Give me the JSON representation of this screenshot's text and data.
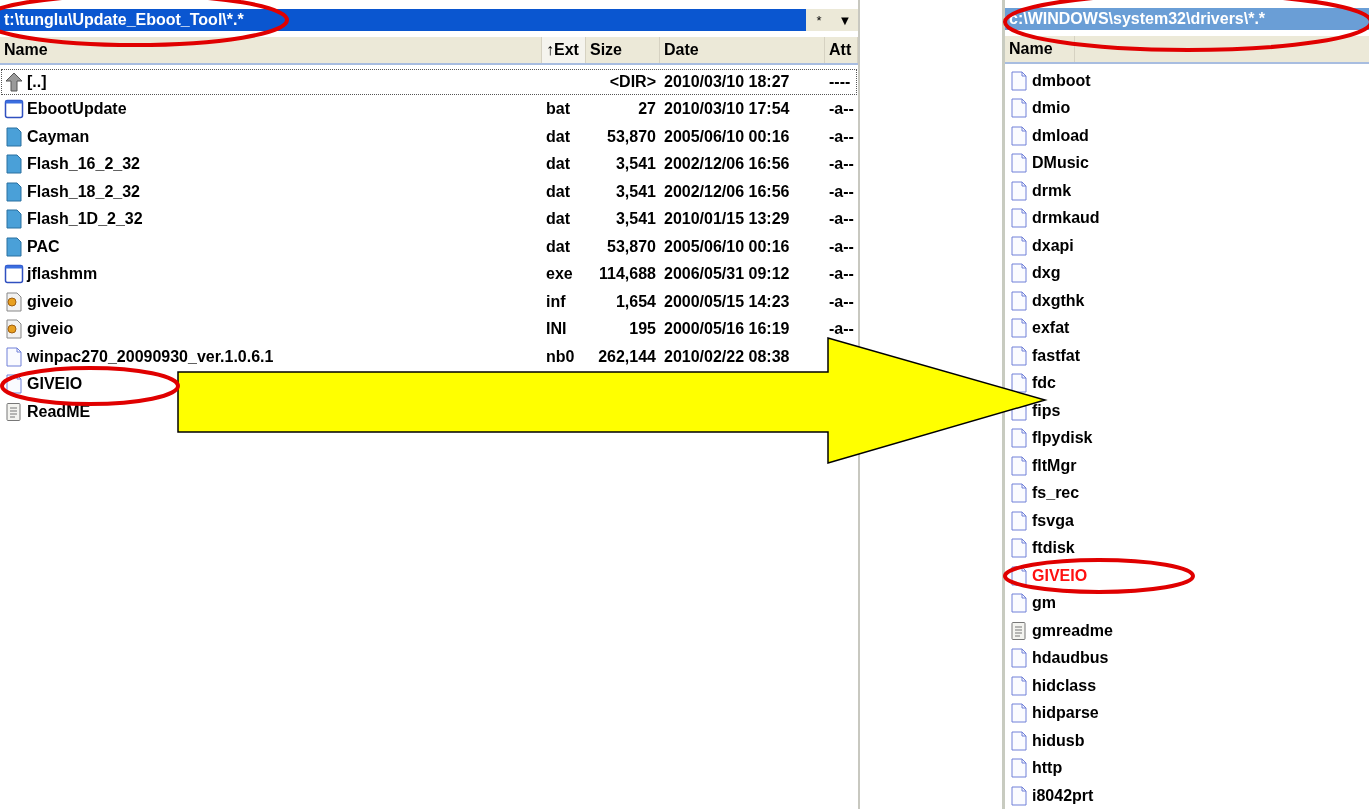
{
  "left_panel": {
    "path": "t:\\tunglu\\Update_Eboot_Tool\\*.*",
    "path_selected": true,
    "filter_button": "*",
    "dropdown_button": "▼",
    "columns": [
      {
        "label": "Name",
        "sorted": false
      },
      {
        "label": "↑Ext",
        "sorted": true
      },
      {
        "label": "Size",
        "sorted": false
      },
      {
        "label": "Date",
        "sorted": false
      },
      {
        "label": "Att",
        "sorted": false
      }
    ],
    "rows": [
      {
        "kind": "up",
        "name": "[..]",
        "ext": "",
        "size": "<DIR>",
        "date": "2010/03/10 18:27",
        "attr": "----",
        "focused": true
      },
      {
        "kind": "program",
        "name": "EbootUpdate",
        "ext": "bat",
        "size": "27",
        "date": "2010/03/10 17:54",
        "attr": "-a--",
        "focused": false
      },
      {
        "kind": "data",
        "name": "Cayman",
        "ext": "dat",
        "size": "53,870",
        "date": "2005/06/10 00:16",
        "attr": "-a--",
        "focused": false
      },
      {
        "kind": "data",
        "name": "Flash_16_2_32",
        "ext": "dat",
        "size": "3,541",
        "date": "2002/12/06 16:56",
        "attr": "-a--",
        "focused": false
      },
      {
        "kind": "data",
        "name": "Flash_18_2_32",
        "ext": "dat",
        "size": "3,541",
        "date": "2002/12/06 16:56",
        "attr": "-a--",
        "focused": false
      },
      {
        "kind": "data",
        "name": "Flash_1D_2_32",
        "ext": "dat",
        "size": "3,541",
        "date": "2010/01/15 13:29",
        "attr": "-a--",
        "focused": false
      },
      {
        "kind": "data",
        "name": "PAC",
        "ext": "dat",
        "size": "53,870",
        "date": "2005/06/10 00:16",
        "attr": "-a--",
        "focused": false
      },
      {
        "kind": "program",
        "name": "jflashmm",
        "ext": "exe",
        "size": "114,688",
        "date": "2006/05/31 09:12",
        "attr": "-a--",
        "focused": false
      },
      {
        "kind": "settings",
        "name": "giveio",
        "ext": "inf",
        "size": "1,654",
        "date": "2000/05/15 14:23",
        "attr": "-a--",
        "focused": false
      },
      {
        "kind": "settings",
        "name": "giveio",
        "ext": "INI",
        "size": "195",
        "date": "2000/05/16 16:19",
        "attr": "-a--",
        "focused": false
      },
      {
        "kind": "file",
        "name": "winpac270_20090930_ver.1.0.6.1",
        "ext": "nb0",
        "size": "262,144",
        "date": "2010/02/22 08:38",
        "attr": "",
        "focused": false
      },
      {
        "kind": "file",
        "name": "GIVEIO",
        "ext": "",
        "size": "",
        "date": "",
        "attr": "",
        "focused": false
      },
      {
        "kind": "text",
        "name": "ReadME",
        "ext": "",
        "size": "",
        "date": "",
        "attr": "",
        "focused": false
      }
    ]
  },
  "right_panel": {
    "path": "c:\\WINDOWS\\system32\\drivers\\*.*",
    "path_selected": false,
    "columns": [
      {
        "label": "Name",
        "sorted": false
      }
    ],
    "rows": [
      {
        "kind": "file",
        "name": "dmboot",
        "marked": false
      },
      {
        "kind": "file",
        "name": "dmio",
        "marked": false
      },
      {
        "kind": "file",
        "name": "dmload",
        "marked": false
      },
      {
        "kind": "file",
        "name": "DMusic",
        "marked": false
      },
      {
        "kind": "file",
        "name": "drmk",
        "marked": false
      },
      {
        "kind": "file",
        "name": "drmkaud",
        "marked": false
      },
      {
        "kind": "file",
        "name": "dxapi",
        "marked": false
      },
      {
        "kind": "file",
        "name": "dxg",
        "marked": false
      },
      {
        "kind": "file",
        "name": "dxgthk",
        "marked": false
      },
      {
        "kind": "file",
        "name": "exfat",
        "marked": false
      },
      {
        "kind": "file",
        "name": "fastfat",
        "marked": false
      },
      {
        "kind": "file",
        "name": "fdc",
        "marked": false
      },
      {
        "kind": "file",
        "name": "fips",
        "marked": false
      },
      {
        "kind": "file",
        "name": "flpydisk",
        "marked": false
      },
      {
        "kind": "file",
        "name": "fltMgr",
        "marked": false
      },
      {
        "kind": "file",
        "name": "fs_rec",
        "marked": false
      },
      {
        "kind": "file",
        "name": "fsvga",
        "marked": false
      },
      {
        "kind": "file",
        "name": "ftdisk",
        "marked": false
      },
      {
        "kind": "file",
        "name": "GIVEIO",
        "marked": true
      },
      {
        "kind": "file",
        "name": "gm",
        "marked": false
      },
      {
        "kind": "text",
        "name": "gmreadme",
        "marked": false
      },
      {
        "kind": "file",
        "name": "hdaudbus",
        "marked": false
      },
      {
        "kind": "file",
        "name": "hidclass",
        "marked": false
      },
      {
        "kind": "file",
        "name": "hidparse",
        "marked": false
      },
      {
        "kind": "file",
        "name": "hidusb",
        "marked": false
      },
      {
        "kind": "file",
        "name": "http",
        "marked": false
      },
      {
        "kind": "file",
        "name": "i8042prt",
        "marked": false
      }
    ]
  }
}
